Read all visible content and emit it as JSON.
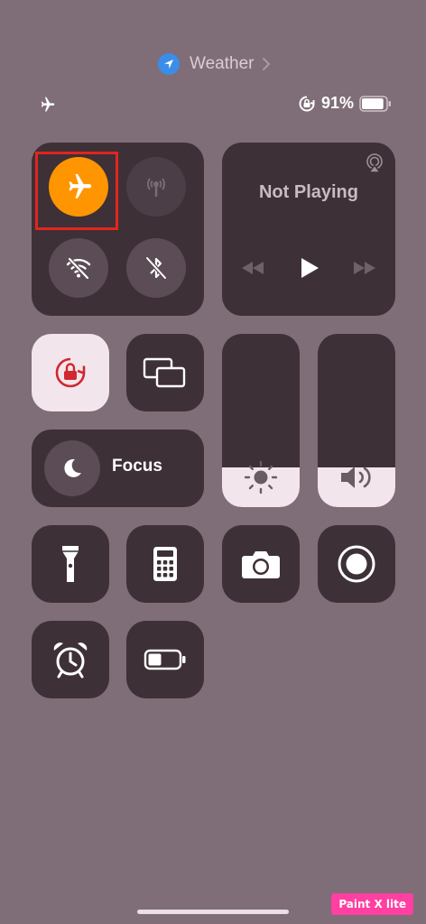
{
  "header": {
    "location_app": "Weather",
    "location_icon": "location-arrow-icon",
    "chevron_icon": "chevron-right-icon"
  },
  "status_bar": {
    "left_icon": "airplane-icon",
    "orientation_lock_icon": "orientation-lock-icon",
    "battery_percent": "91%",
    "battery_level": 0.91
  },
  "connectivity": {
    "airplane_mode": {
      "icon": "airplane-icon",
      "on": true
    },
    "cellular": {
      "icon": "cellular-antenna-icon",
      "on": false
    },
    "wifi": {
      "icon": "wifi-off-icon",
      "on": false
    },
    "bluetooth": {
      "icon": "bluetooth-off-icon",
      "on": false
    }
  },
  "media": {
    "title": "Not Playing",
    "airplay_icon": "airplay-icon",
    "controls": [
      "rewind-icon",
      "play-icon",
      "fast-forward-icon"
    ]
  },
  "controls": {
    "orientation_lock": {
      "icon": "orientation-lock-icon",
      "on": true
    },
    "screen_mirroring": {
      "icon": "screen-mirroring-icon"
    },
    "focus": {
      "label": "Focus",
      "icon": "moon-icon"
    }
  },
  "sliders": {
    "brightness": {
      "icon": "sun-icon",
      "level": 0.23
    },
    "volume": {
      "icon": "speaker-icon",
      "level": 0.23
    }
  },
  "shortcuts": [
    "flashlight-icon",
    "calculator-icon",
    "camera-icon",
    "screen-record-icon",
    "alarm-icon",
    "low-power-battery-icon"
  ],
  "annotation": {
    "color": "#e0261f",
    "target": "airplane-mode-toggle"
  },
  "watermark": "Paint X lite",
  "colors": {
    "background": "#7f6d77",
    "tile": "#3d3037",
    "airplane_active": "#ff9500",
    "lock_active": "#d1272f",
    "light_tile": "#f2e6ec"
  }
}
